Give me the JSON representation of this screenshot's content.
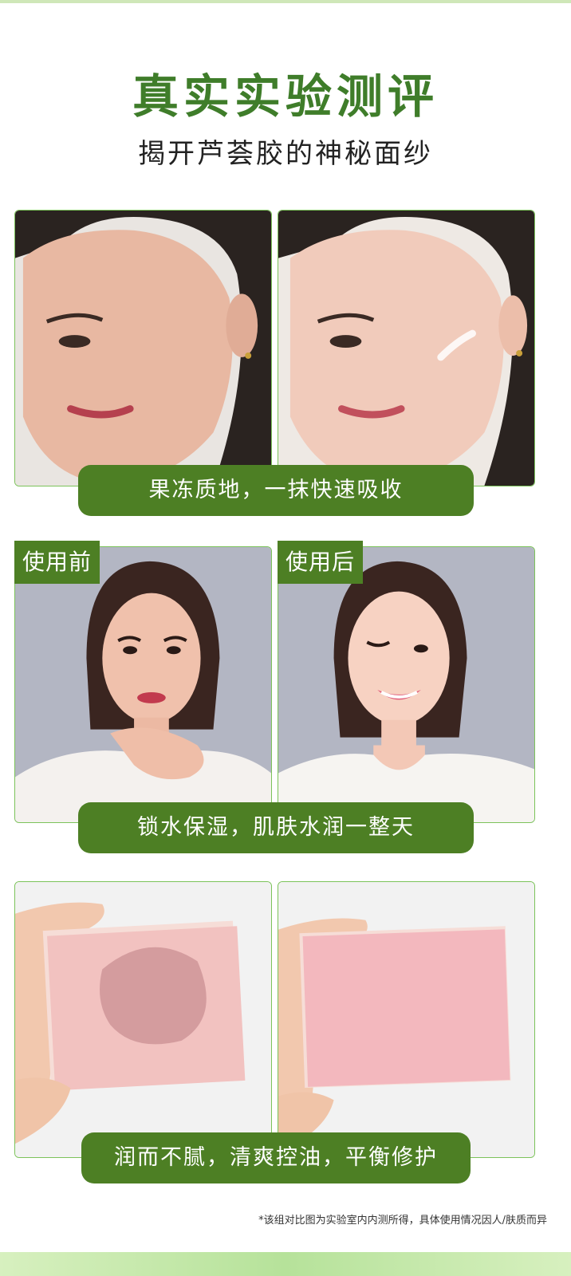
{
  "header": {
    "title": "真实实验测评",
    "subtitle": "揭开芦荟胶的神秘面纱"
  },
  "sections": [
    {
      "caption": "果冻质地，一抹快速吸收"
    },
    {
      "caption": "锁水保湿，肌肤水润一整天",
      "tags": [
        "使用前",
        "使用后"
      ]
    },
    {
      "caption": "润而不腻，清爽控油，平衡修护"
    }
  ],
  "footnote": "*该组对比图为实验室内内测所得，具体使用情况因人/肤质而异",
  "colors": {
    "accent": "#4d7f24",
    "title": "#3f7d2a",
    "frame": "#7cc35a"
  }
}
